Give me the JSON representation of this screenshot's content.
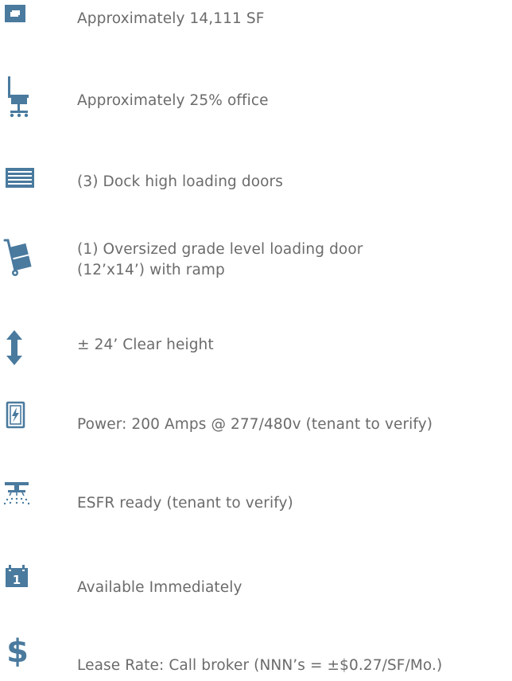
{
  "colors": {
    "icon": "#4a7a9e",
    "text": "#6b6b6b",
    "background": "#ffffff"
  },
  "features": [
    {
      "icon": "square-footage-icon",
      "lines": [
        "Approximately 14,111 SF"
      ]
    },
    {
      "icon": "office-chair-icon",
      "lines": [
        "Approximately 25% office"
      ]
    },
    {
      "icon": "dock-door-icon",
      "lines": [
        "(3) Dock high loading doors"
      ]
    },
    {
      "icon": "hand-truck-icon",
      "lines": [
        "(1) Oversized grade level loading door",
        "(12’x14’) with ramp"
      ]
    },
    {
      "icon": "vertical-arrow-icon",
      "lines": [
        "± 24’ Clear height"
      ]
    },
    {
      "icon": "power-icon",
      "lines": [
        "Power: 200 Amps @ 277/480v (tenant to verify)"
      ]
    },
    {
      "icon": "sprinkler-icon",
      "lines": [
        "ESFR ready (tenant to verify)"
      ]
    },
    {
      "icon": "calendar-icon",
      "lines": [
        "Available Immediately"
      ]
    },
    {
      "icon": "dollar-icon",
      "lines": [
        "Lease Rate: Call broker (NNN’s = ±$0.27/SF/Mo.)"
      ]
    }
  ]
}
